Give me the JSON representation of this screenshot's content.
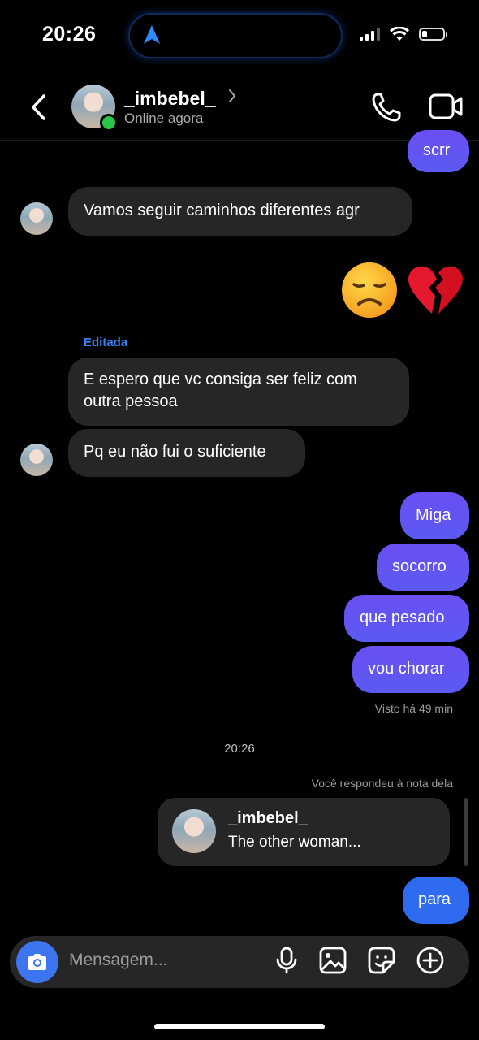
{
  "status_bar": {
    "time": "20:26",
    "signal_icon": "cellular-signal-icon",
    "wifi_icon": "wifi-icon",
    "battery_icon": "battery-icon",
    "battery_level": 0.25
  },
  "header": {
    "username": "_imbebel_",
    "status": "Online agora",
    "back_icon": "chevron-left-icon",
    "call_icon": "phone-icon",
    "video_icon": "video-camera-icon"
  },
  "messages": {
    "m0": "scrr",
    "m1": "Vamos seguir caminhos diferentes agr",
    "emoji": [
      "😞",
      "💔"
    ],
    "edited_label": "Editada",
    "m2_line1": "E espero que vc consiga ser feliz com",
    "m2_line2": "outra pessoa",
    "m3": "Pq eu não fui o suficiente",
    "m4": "Miga",
    "m5": "socorro",
    "m6": "que pesado",
    "m7": "vou chorar",
    "seen": "Visto há 49 min",
    "time_sep": "20:26",
    "note_reply_label": "Você respondeu à nota dela",
    "note_user": "_imbebel_",
    "note_text": "The other woman...",
    "m8": "para"
  },
  "composer": {
    "placeholder": "Mensagem...",
    "camera_icon": "camera-icon",
    "mic_icon": "microphone-icon",
    "gallery_icon": "image-icon",
    "sticker_icon": "sticker-icon",
    "plus_icon": "plus-circle-icon"
  },
  "colors": {
    "background": "#000000",
    "incoming_bubble": "#262626",
    "outgoing_bubble": "#6251f1",
    "outgoing_blue": "#2f6bf0",
    "online": "#29c54a",
    "edited": "#3b82f6"
  }
}
